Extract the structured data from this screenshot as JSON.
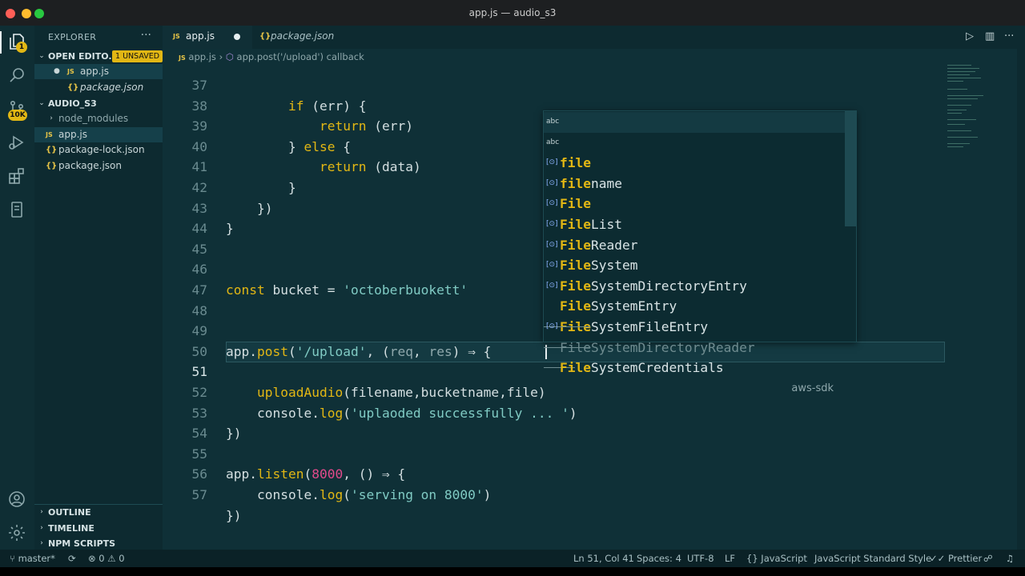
{
  "window": {
    "title": "app.js — audio_s3"
  },
  "activity": {
    "explorer_badge": "1",
    "scm_badge": "10K"
  },
  "sidebar": {
    "title": "EXPLORER",
    "open_editors": {
      "label": "OPEN EDITO...",
      "badge": "1 UNSAVED",
      "files": [
        {
          "icon": "JS",
          "name": "app.js"
        },
        {
          "icon": "{}",
          "name": "package.json"
        }
      ]
    },
    "project": {
      "label": "AUDIO_S3",
      "items": [
        {
          "icon": "",
          "name": "node_modules"
        },
        {
          "icon": "JS",
          "name": "app.js"
        },
        {
          "icon": "{}",
          "name": "package-lock.json"
        },
        {
          "icon": "{}",
          "name": "package.json"
        }
      ]
    },
    "bottom_sections": [
      "OUTLINE",
      "TIMELINE",
      "NPM SCRIPTS"
    ]
  },
  "tabs": [
    {
      "icon": "JS",
      "label": "app.js"
    },
    {
      "icon": "{}",
      "label": "package.json"
    }
  ],
  "breadcrumb": {
    "file": "app.js",
    "separator": "›",
    "symbol": "app.post('/upload') callback"
  },
  "editor": {
    "line_numbers": [
      "37",
      "38",
      "39",
      "40",
      "41",
      "42",
      "43",
      "44",
      "45",
      "46",
      "47",
      "48",
      "49",
      "50",
      "51",
      "52",
      "53",
      "54",
      "55",
      "56",
      "57"
    ],
    "code": {
      "l37_kw": "if",
      "l37_rest": " (err) {",
      "l38_kw": "return",
      "l38_rest": " (err)",
      "l39_open": "} ",
      "l39_kw": "else",
      "l39_rest": " {",
      "l40_kw": "return",
      "l40_rest": " (data)",
      "l41": "}",
      "l42": "})",
      "l43": "}",
      "l46_kw": "const",
      "l46_mid": " bucket = ",
      "l46_str": "'octoberbuokett'",
      "l49_a": "app",
      "l49_dot": ".",
      "l49_fn": "post",
      "l49_p1": "(",
      "l49_str": "'/upload'",
      "l49_p2": ", (",
      "l49_req": "req",
      "l49_comma": ", ",
      "l49_res": "res",
      "l49_end": ") ⇒ {",
      "l51_fn": "uploadAudio",
      "l51_args": "(filename,bucketname,file)",
      "l52_a": "console.",
      "l52_fn": "log",
      "l52_p1": "(",
      "l52_str": "'uplaoded successfully ... '",
      "l52_p2": ")",
      "l53": "})",
      "l55_a": "app.",
      "l55_fn": "listen",
      "l55_p1": "(",
      "l55_num": "8000",
      "l55_p2": ", () ⇒ {",
      "l56_a": "console.",
      "l56_fn": "log",
      "l56_p1": "(",
      "l56_str": "'serving on 8000'",
      "l56_p2": ")",
      "l57": "})"
    }
  },
  "suggestions": [
    {
      "icon": "abc",
      "match": "file",
      "rest": "",
      "detail": ""
    },
    {
      "icon": "abc",
      "match": "file",
      "rest": "name",
      "detail": ""
    },
    {
      "icon": "[⊙]",
      "match": "File",
      "rest": "",
      "detail": ""
    },
    {
      "icon": "[⊙]",
      "match": "File",
      "rest": "List",
      "detail": ""
    },
    {
      "icon": "[⊙]",
      "match": "File",
      "rest": "Reader",
      "detail": ""
    },
    {
      "icon": "[⊙]",
      "match": "File",
      "rest": "System",
      "detail": ""
    },
    {
      "icon": "[⊙]",
      "match": "File",
      "rest": "SystemDirectoryEntry",
      "detail": ""
    },
    {
      "icon": "[⊙]",
      "match": "File",
      "rest": "SystemEntry",
      "detail": ""
    },
    {
      "icon": "[⊙]",
      "match": "File",
      "rest": "SystemFileEntry",
      "detail": ""
    },
    {
      "icon": "",
      "match": "File",
      "rest": "SystemDirectoryReader",
      "detail": ""
    },
    {
      "icon": "[⊙]",
      "match": "File",
      "rest": "SystemCredentials",
      "detail": "aws-sdk"
    }
  ],
  "status": {
    "branch": "master*",
    "errors": "0",
    "warnings": "0",
    "position": "Ln 51, Col 41",
    "spaces": "Spaces: 4",
    "encoding": "UTF-8",
    "eol": "LF",
    "language": "JavaScript",
    "linter": "JavaScript Standard Style",
    "formatter": "Prettier"
  },
  "colors": {
    "accent": "#e2b714",
    "editor_bg": "#0f3037",
    "sidebar_bg": "#0d2a30",
    "string": "#80cbc4",
    "number": "#e34a8c"
  }
}
